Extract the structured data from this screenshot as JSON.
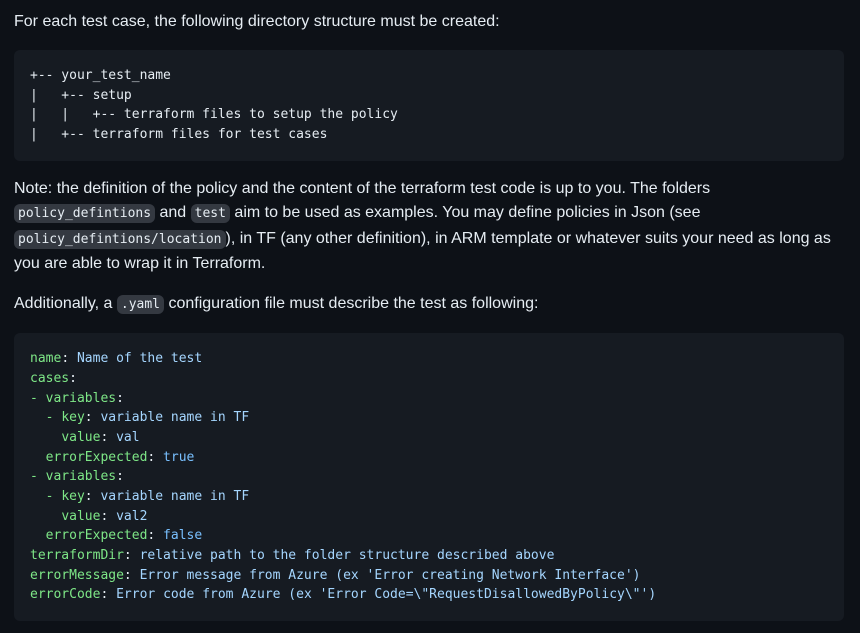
{
  "intro": "For each test case, the following directory structure must be created:",
  "tree_lines": [
    "+-- your_test_name",
    "|   +-- setup",
    "|   |   +-- terraform files to setup the policy",
    "|   +-- terraform files for test cases"
  ],
  "note": {
    "t1": "Note: the definition of the policy and the content of the terraform test code is up to you. The folders ",
    "code1": "policy_defintions",
    "t2": " and ",
    "code2": "test",
    "t3": " aim to be used as examples. You may define policies in Json (see ",
    "code3": "policy_defintions/location",
    "t4": "), in TF (any other definition), in ARM template or whatever suits your need as long as you are able to wrap it in Terraform."
  },
  "additionally": {
    "t1": "Additionally, a ",
    "code": ".yaml",
    "t2": " configuration file must describe the test as following:"
  },
  "yaml": {
    "l1k": "name",
    "l1v": " Name of the test",
    "l2k": "cases",
    "l3k": "variables",
    "l4k": "key",
    "l4v": " variable name in TF",
    "l5k": "value",
    "l5v": " val",
    "l6k": "errorExpected",
    "l6v": " true",
    "l7k": "variables",
    "l8k": "key",
    "l8v": " variable name in TF",
    "l9k": "value",
    "l9v": " val2",
    "l10k": "errorExpected",
    "l10v": " false",
    "l11k": "terraformDir",
    "l11v": " relative path to the folder structure described above",
    "l12k": "errorMessage",
    "l12v": " Error message from Azure (ex 'Error creating Network Interface')",
    "l13k": "errorCode",
    "l13v": " Error code from Azure (ex 'Error Code=\\\"RequestDisallowedByPolicy\\\"')"
  },
  "colors": {
    "background": "#0d1117",
    "code_background": "#161b22",
    "yaml_key": "#7ee787",
    "yaml_string": "#a5d6ff",
    "yaml_bool": "#79c0ff"
  }
}
